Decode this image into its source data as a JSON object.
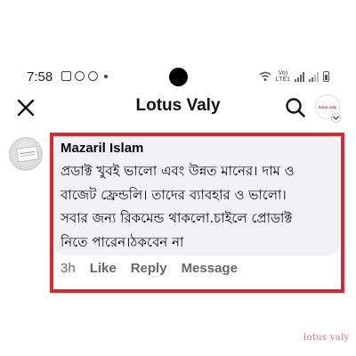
{
  "status_bar": {
    "time": "7:58",
    "dot": "•",
    "network_label_top": "Vo)",
    "network_label_bottom": "LTE1",
    "icons": [
      "gallery-icon",
      "messenger-icon",
      "messenger-icon",
      "wifi-icon",
      "signal-icon",
      "signal-icon",
      "battery-icon"
    ]
  },
  "header": {
    "title": "Lotus Valy",
    "profile_logo_text": "lotus valy"
  },
  "comment": {
    "author": "Mazaril Islam",
    "lines": [
      "প্রডাক্ট খুবই ভালো এবং উন্নত মানের। দাম ও",
      "বাজেট ফ্রেন্ডলি। তাদের ব্যাবহার ও ভালো।",
      "সবার জন্য রিকমেন্ড থাকলো.চাইলে প্রোডাক্ট",
      "নিতে পারেন।ঠকবেন না"
    ],
    "time": "3h",
    "actions": {
      "like": "Like",
      "reply": "Reply",
      "message": "Message"
    }
  },
  "watermark": "lotus valy",
  "colors": {
    "highlight_border": "#e0262d",
    "bubble_background": "#f0f2f5",
    "secondary_text": "#65676b"
  }
}
